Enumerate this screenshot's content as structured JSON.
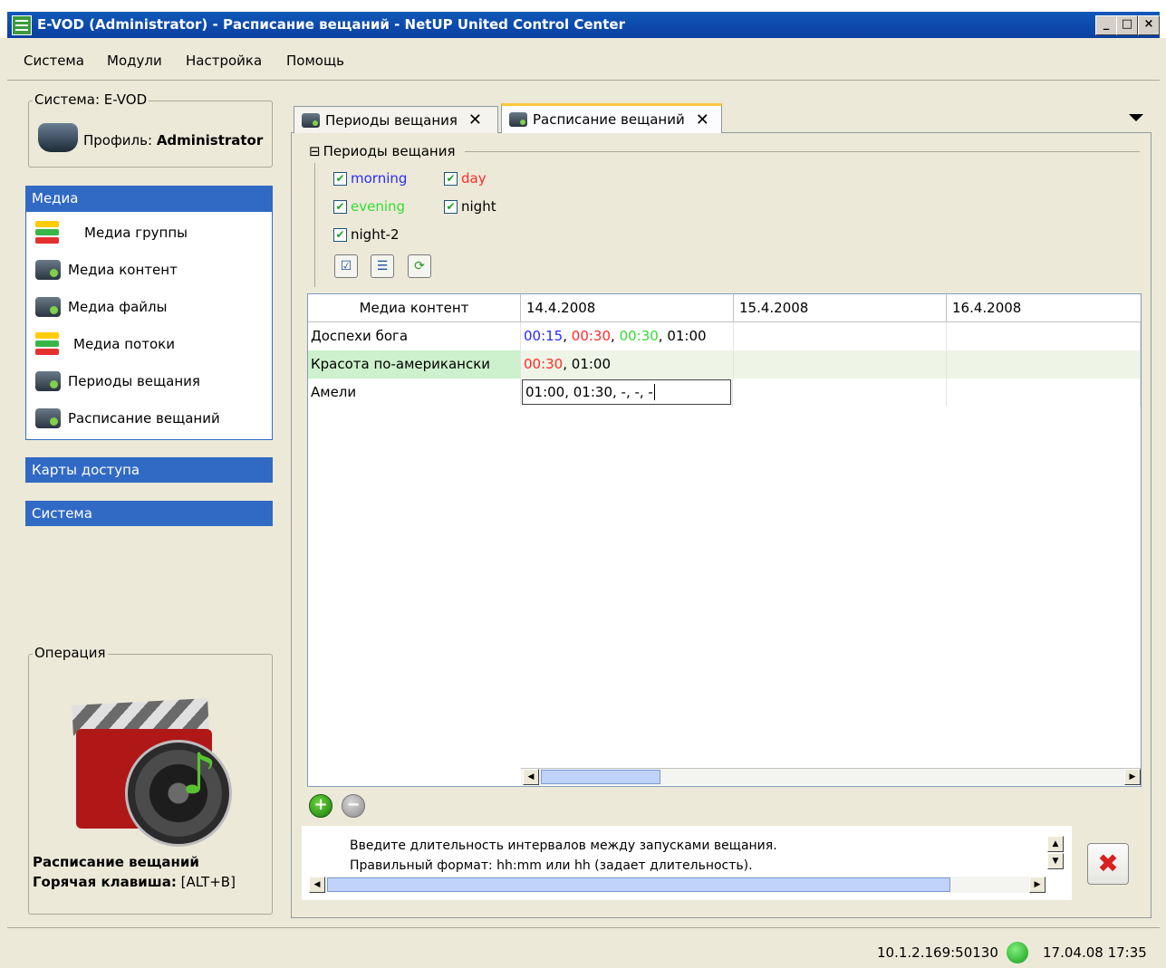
{
  "window": {
    "title": "E-VOD (Administrator) - Расписание вещаний - NetUP United Control Center",
    "min": "_",
    "max": "□",
    "close": "×"
  },
  "menu": [
    "Система",
    "Модули",
    "Настройка",
    "Помощь"
  ],
  "system_box": {
    "title": "Система: E-VOD",
    "profile_label": "Профиль:",
    "profile_value": "Administrator"
  },
  "media_panel": {
    "header": "Медиа",
    "items": [
      {
        "label": "Медиа группы",
        "icon": "arrows-icon"
      },
      {
        "label": "Медиа контент",
        "icon": "camera-icon"
      },
      {
        "label": "Медиа файлы",
        "icon": "camera-icon"
      },
      {
        "label": "Медиа потоки",
        "icon": "arrows-icon"
      },
      {
        "label": "Периоды вещания",
        "icon": "camera-icon"
      },
      {
        "label": "Расписание вещаний",
        "icon": "camera-icon"
      }
    ]
  },
  "access_cards_header": "Карты доступа",
  "system_header": "Система",
  "operation": {
    "title": "Операция",
    "name": "Расписание вещаний",
    "hotkey_label": "Горячая клавиша:",
    "hotkey": "[ALT+B]"
  },
  "tabs": [
    {
      "label": "Периоды вещания",
      "active": false
    },
    {
      "label": "Расписание вещаний",
      "active": true
    }
  ],
  "periods": {
    "title": "Периоды вещания",
    "collapse": "⊟",
    "items": [
      {
        "label": "morning",
        "checked": true,
        "color": "#2a2aff"
      },
      {
        "label": "day",
        "checked": true,
        "color": "#ff2a2a"
      },
      {
        "label": "evening",
        "checked": true,
        "color": "#33dd33"
      },
      {
        "label": "night",
        "checked": true,
        "color": "#000000"
      },
      {
        "label": "night-2",
        "checked": true,
        "color": "#000000"
      }
    ]
  },
  "table": {
    "headers": [
      "Медиа контент",
      "14.4.2008",
      "15.4.2008",
      "16.4.2008"
    ],
    "rows": [
      {
        "name": "Доспехи бога",
        "selected": false,
        "cell": [
          {
            "t": "00:15",
            "c": "#2a2aff"
          },
          {
            "t": ", ",
            "c": "#000"
          },
          {
            "t": "00:30",
            "c": "#ff2a2a"
          },
          {
            "t": ", ",
            "c": "#000"
          },
          {
            "t": "00:30",
            "c": "#33dd33"
          },
          {
            "t": ", 01:00",
            "c": "#000"
          }
        ]
      },
      {
        "name": "Красота по-американски",
        "selected": true,
        "cell": [
          {
            "t": "00:30",
            "c": "#ff2a2a"
          },
          {
            "t": ", 01:00",
            "c": "#000"
          }
        ]
      },
      {
        "name": "Амели",
        "selected": false,
        "editing": "01:00, 01:30, -, -, -"
      }
    ]
  },
  "message": {
    "line1": "Введите длительность интервалов между запусками вещания.",
    "line2": "Правильный формат: hh:mm или hh (задает длительность)."
  },
  "status": {
    "address": "10.1.2.169:50130",
    "datetime": "17.04.08 17:35",
    "connection_color": "#22bb22"
  }
}
